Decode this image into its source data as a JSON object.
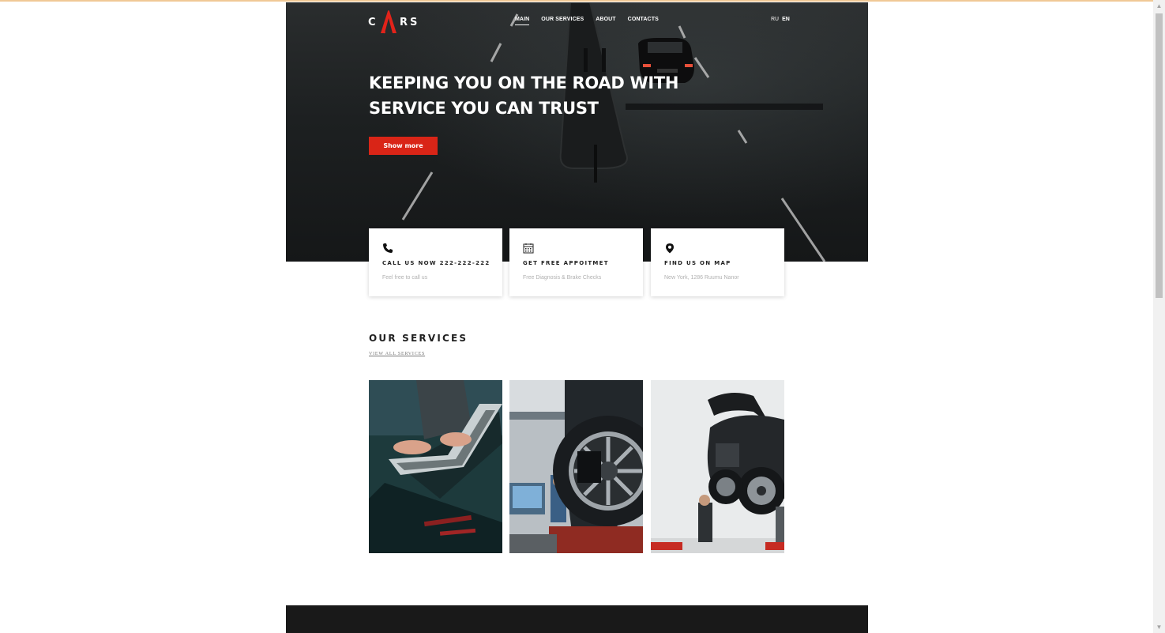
{
  "header": {
    "logo": {
      "left": "C",
      "right": "RS"
    },
    "nav": [
      {
        "label": "MAIN",
        "active": true
      },
      {
        "label": "OUR SERVICES"
      },
      {
        "label": "ABOUT"
      },
      {
        "label": "CONTACTS"
      }
    ],
    "languages": [
      "RU",
      "EN"
    ]
  },
  "hero": {
    "title_line1": "KEEPING YOU ON THE ROAD WITH",
    "title_line2": "SERVICE YOU CAN TRUST",
    "button_label": "Show more"
  },
  "cards": [
    {
      "icon": "phone-icon",
      "title": "CALL US NOW 222-222-222",
      "subtitle": "Feel free to call us"
    },
    {
      "icon": "calendar-icon",
      "title": "GET FREE APPOITMET",
      "subtitle": "Free Diagnosis & Brake Checks"
    },
    {
      "icon": "map-pin-icon",
      "title": "FIND US ON MAP",
      "subtitle": "New York, 1286 Ruumu Nanor"
    }
  ],
  "services": {
    "heading": "OUR SERVICES",
    "view_all": "VIEW ALL SERVICES",
    "images": [
      "laptop-diagnostics-photo",
      "wheel-alignment-photo",
      "car-lift-mechanic-photo"
    ]
  },
  "colors": {
    "accent": "#d92517",
    "footer": "#191919"
  }
}
